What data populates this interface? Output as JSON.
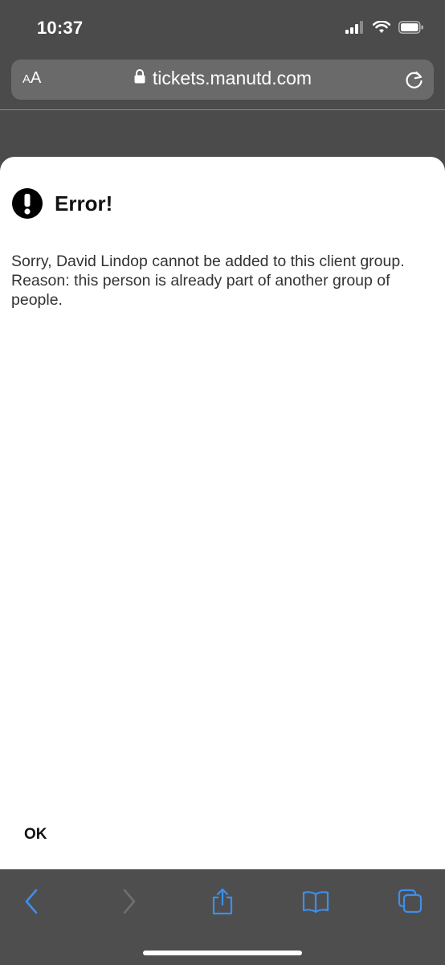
{
  "status_bar": {
    "time": "10:37",
    "icons": [
      "cellular-signal-icon",
      "wifi-icon",
      "battery-icon"
    ]
  },
  "address_bar": {
    "text_size_label_small": "A",
    "text_size_label_large": "A",
    "url": "tickets.manutd.com",
    "lock_icon": "lock-icon",
    "reload_icon": "reload-icon"
  },
  "modal": {
    "title": "Error!",
    "icon": "exclamation-circle-icon",
    "message_line1": "Sorry, David Lindop cannot be added to this client group.",
    "message_line2": "Reason: this person is already part of another group of people.",
    "ok_label": "OK"
  },
  "toolbar": {
    "buttons": [
      "back-icon",
      "forward-icon",
      "share-icon",
      "bookmarks-icon",
      "tabs-icon"
    ]
  },
  "colors": {
    "accent": "#3d8fea",
    "disabled": "#6f6f6f",
    "chrome_background": "#4b4b4b",
    "modal_background": "#ffffff"
  }
}
